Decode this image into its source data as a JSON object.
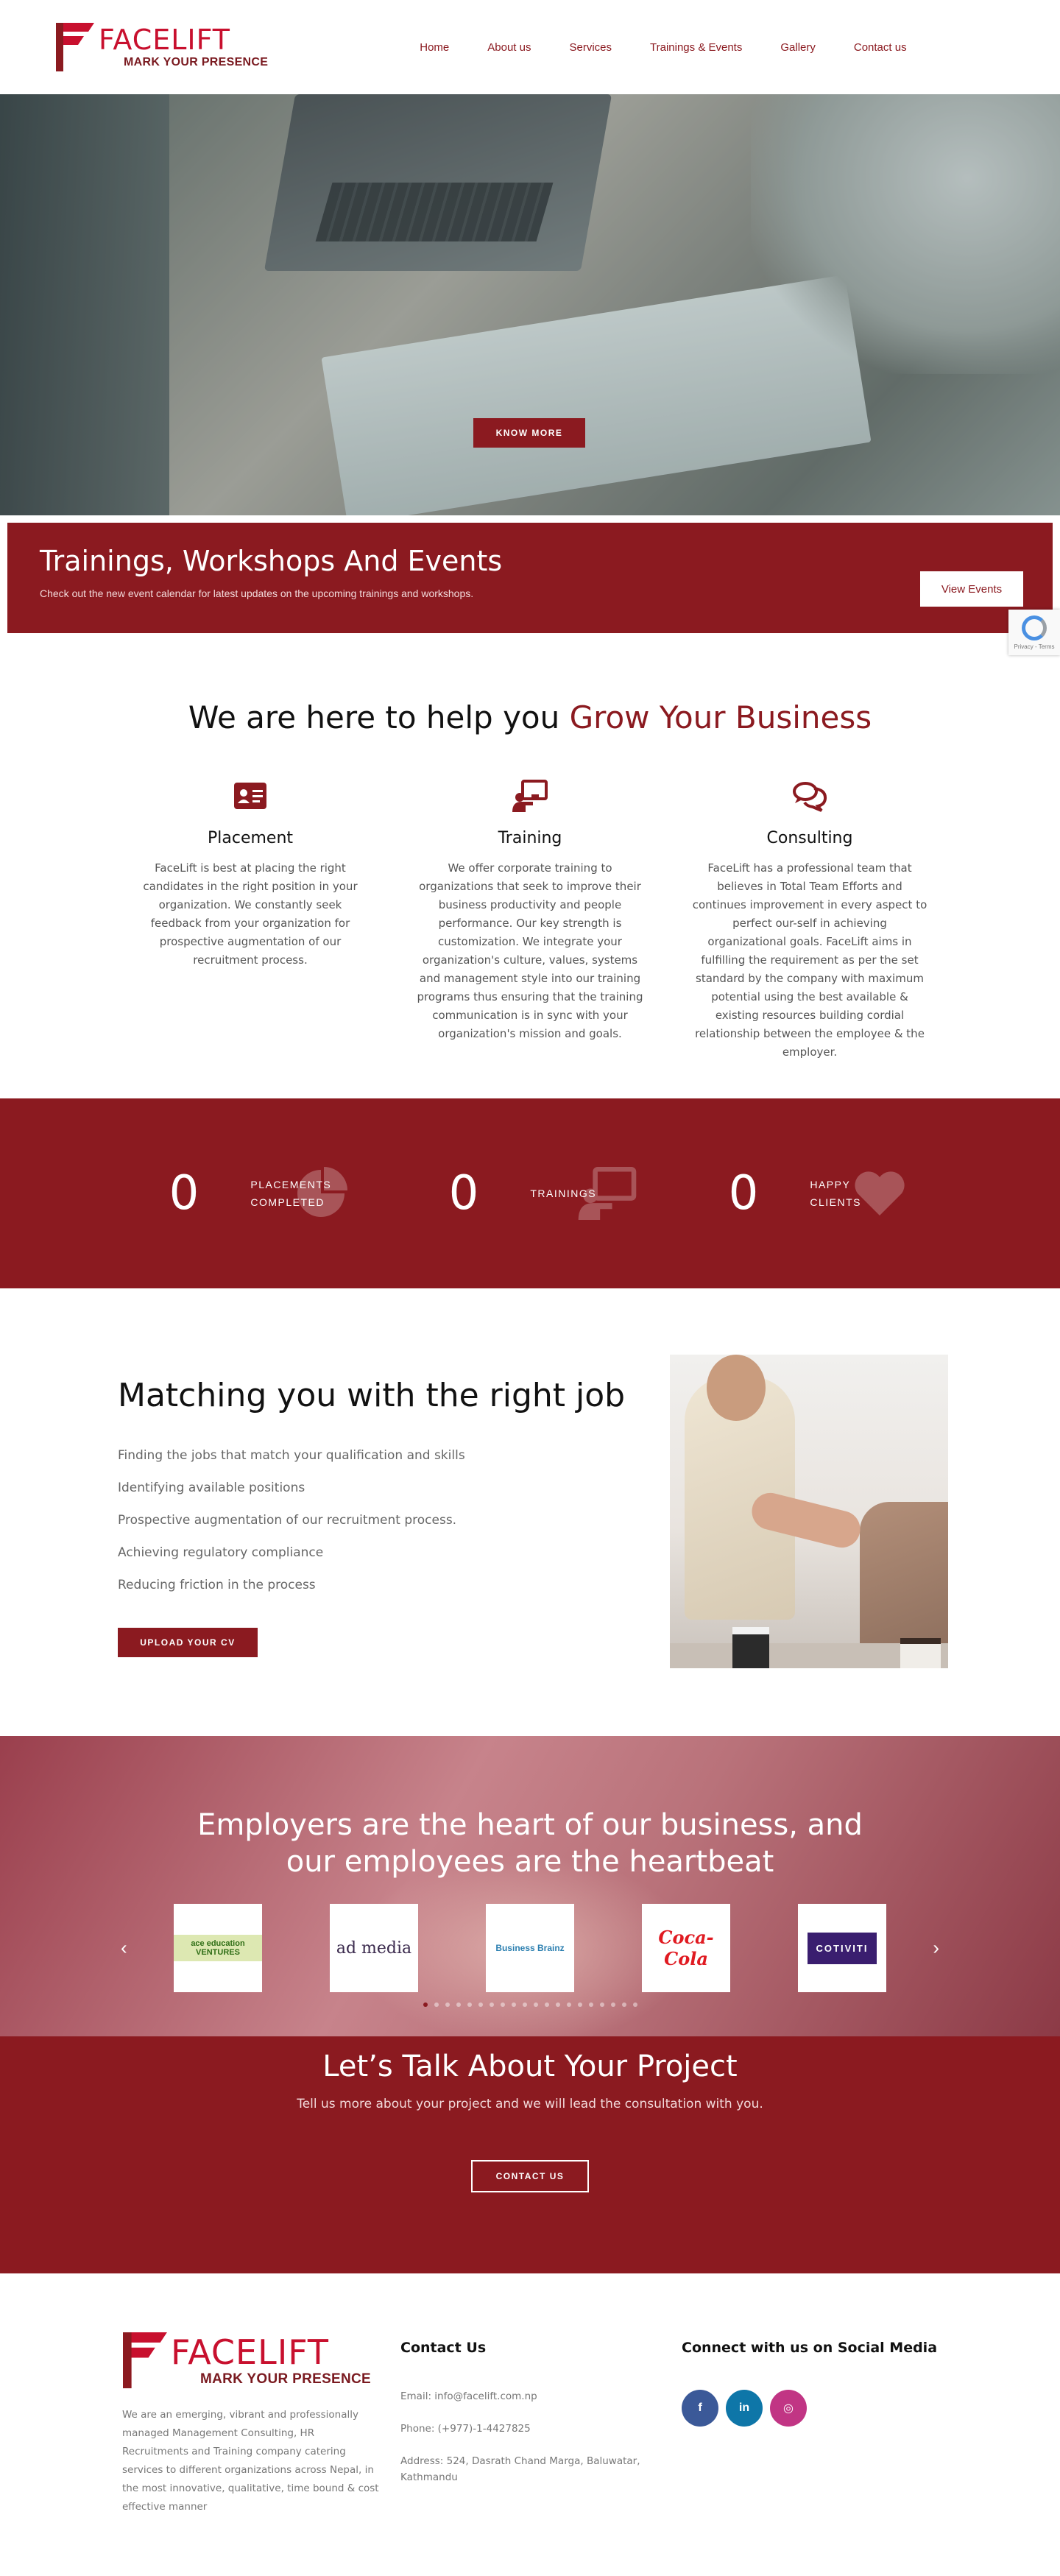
{
  "brand": {
    "name": "FACELIFT",
    "tagline": "MARK YOUR PRESENCE",
    "primary_color": "#8b1a20",
    "logo_color": "#c8102e"
  },
  "nav": {
    "items": [
      "Home",
      "About us",
      "Services",
      "Trainings & Events",
      "Gallery",
      "Contact us"
    ]
  },
  "hero": {
    "button_label": "KNOW MORE"
  },
  "trainings_banner": {
    "title": "Trainings, Workshops And Events",
    "subtitle": "Check out the new event calendar for latest updates on the upcoming trainings and workshops.",
    "button_label": "View Events",
    "recaptcha_text": "Privacy - Terms"
  },
  "help": {
    "title_prefix": "We are here to help you ",
    "title_accent": "Grow Your Business",
    "services": [
      {
        "icon": "id-card-icon",
        "title": "Placement",
        "text": "FaceLift is best at placing the right candidates in the right position in your organization. We constantly seek feedback from your organization for prospective augmentation of our recruitment process."
      },
      {
        "icon": "presenter-icon",
        "title": "Training",
        "text": "We offer corporate training to organizations that seek to improve their business productivity and people performance. Our key strength is customization. We integrate your organization's culture, values, systems and management style into our training programs thus ensuring that the training communication is in sync with your organization's mission and goals."
      },
      {
        "icon": "chat-bubbles-icon",
        "title": "Consulting",
        "text": "FaceLift has a professional team that believes in Total Team Efforts and continues improvement in every aspect to perfect our-self in achieving organizational goals. FaceLift aims in fulfilling the requirement as per the set standard by the company with maximum potential using the best available & existing resources building cordial relationship between the employee & the employer."
      }
    ]
  },
  "stats": [
    {
      "value": "0",
      "label_line1": "PLACEMENTS",
      "label_line2": "COMPLETED",
      "icon": "pie-chart-icon"
    },
    {
      "value": "0",
      "label_line1": "TRAININGS",
      "label_line2": "",
      "icon": "presenter-icon"
    },
    {
      "value": "0",
      "label_line1": "HAPPY",
      "label_line2": "CLIENTS",
      "icon": "heart-icon"
    }
  ],
  "matching": {
    "title": "Matching you with the right job",
    "points": [
      "Finding the jobs that match your qualification and skills",
      "Identifying available positions",
      "Prospective augmentation of our recruitment process.",
      " Achieving regulatory compliance",
      " Reducing friction in the process"
    ],
    "button_label": "UPLOAD YOUR CV"
  },
  "employers": {
    "title_line1": "Employers are the heart of our business, and",
    "title_line2": "our employees are the heartbeat",
    "clients": [
      "ace education VENTURES",
      "ad media",
      "Business Brainz",
      "Coca-Cola",
      "COTIVITI"
    ],
    "active_dot": 0
  },
  "project": {
    "title": "Let’s Talk About Your Project",
    "subtitle": "Tell us more about your project and we will lead the consultation with you.",
    "button_label": "CONTACT US"
  },
  "footer": {
    "about": "We are an emerging, vibrant and  professionally managed Management Consulting, HR Recruitments and Training company catering services to different organizations across Nepal, in the most innovative, qualitative, time bound & cost effective manner",
    "contact_title": "Contact Us",
    "email": "Email: info@facelift.com.np",
    "phone": "Phone: (+977)-1-4427825",
    "address": "Address: 524, Dasrath Chand Marga, Baluwatar, Kathmandu",
    "social_title": "Connect with us on Social Media",
    "socials": [
      {
        "name": "facebook",
        "glyph": "f",
        "color": "#3b5998"
      },
      {
        "name": "linkedin",
        "glyph": "in",
        "color": "#0e76a8"
      },
      {
        "name": "instagram",
        "glyph": "◎",
        "color": "#c13584"
      }
    ]
  }
}
